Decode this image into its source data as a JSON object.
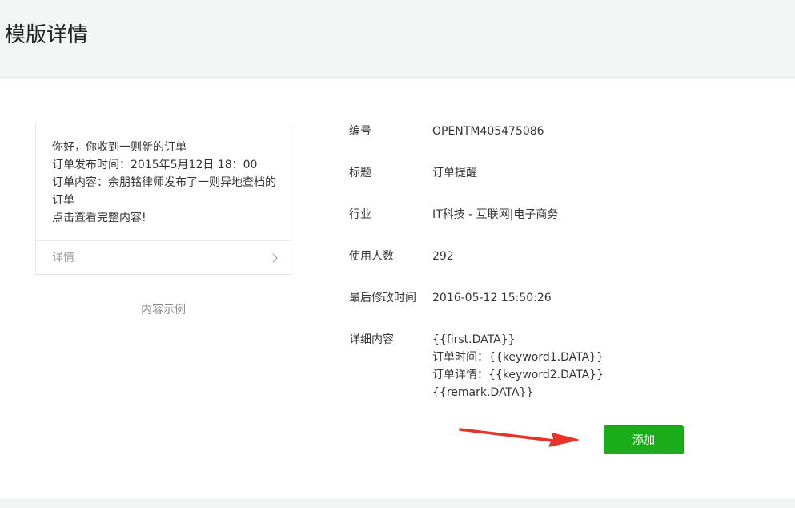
{
  "header": {
    "title": "模版详情"
  },
  "preview": {
    "lines": [
      "你好，你收到一则新的订单",
      "订单发布时间：2015年5月12日 18：00",
      "订单内容：余朋铭律师发布了一则异地查档的",
      "订单",
      "点击查看完整内容!"
    ],
    "footer_label": "详情",
    "caption": "内容示例"
  },
  "info": {
    "id": {
      "label": "编号",
      "value": "OPENTM405475086"
    },
    "title": {
      "label": "标题",
      "value": "订单提醒"
    },
    "industry": {
      "label": "行业",
      "value": "IT科技 - 互联网|电子商务"
    },
    "users": {
      "label": "使用人数",
      "value": "292"
    },
    "modified": {
      "label": "最后修改时间",
      "value": "2016-05-12 15:50:26"
    },
    "detail": {
      "label": "详细内容",
      "lines": [
        "{{first.DATA}}",
        "订单时间：{{keyword1.DATA}}",
        "订单详情：{{keyword2.DATA}}",
        "{{remark.DATA}}"
      ]
    }
  },
  "actions": {
    "add_label": "添加"
  },
  "colors": {
    "primary_button": "#1aad19",
    "arrow": "#e8322a",
    "header_bg": "#f4f5f5"
  },
  "icons": {
    "footer_chevron": "chevron-right-icon",
    "annotation": "red-arrow-icon"
  }
}
